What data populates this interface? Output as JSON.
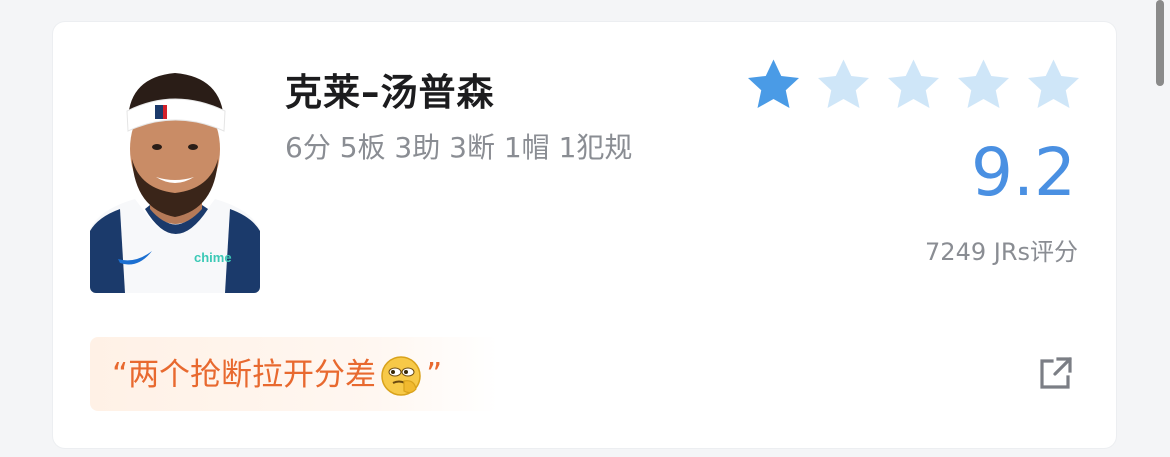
{
  "player": {
    "name": "克莱–汤普森",
    "stats": "6分 5板 3助 3断 1帽 1犯规"
  },
  "rating": {
    "stars_filled": 1,
    "stars_total": 5,
    "score": "9.2",
    "count_label": "7249 JRs评分"
  },
  "comment": {
    "open_quote": "“",
    "text": "两个抢断拉开分差",
    "close_quote": "”",
    "emoji_icon": "thinking-emoji-icon"
  },
  "icons": {
    "share": "share-external-icon",
    "star": "star-icon"
  },
  "colors": {
    "star_filled": "#4a9be6",
    "star_empty": "#cfe6f8",
    "score": "#4a90e2",
    "quote_text": "#e8692f",
    "quote_bg": "#fff1e6"
  }
}
